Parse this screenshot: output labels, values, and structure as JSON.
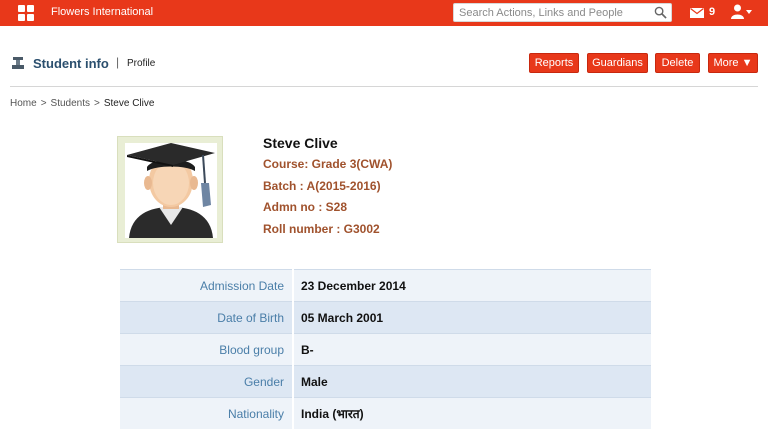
{
  "topbar": {
    "org_name": "Flowers International",
    "search_placeholder": "Search Actions, Links and People",
    "mail_count": "9",
    "accent_color": "#e8381a"
  },
  "header": {
    "title": "Student info",
    "separator": "|",
    "subtitle": "Profile",
    "buttons": {
      "reports": "Reports",
      "guardians": "Guardians",
      "delete": "Delete",
      "more": "More ▼"
    }
  },
  "breadcrumb": {
    "home": "Home",
    "sep1": ">",
    "students": "Students",
    "sep2": ">",
    "current": "Steve Clive"
  },
  "student": {
    "name": "Steve Clive",
    "course": "Course: Grade 3(CWA)",
    "batch": "Batch : A(2015-2016)",
    "admn_no": "Admn no : S28",
    "roll_number": "Roll number : G3002"
  },
  "details": [
    {
      "label": "Admission Date",
      "value": "23 December 2014"
    },
    {
      "label": "Date of Birth",
      "value": "05 March 2001"
    },
    {
      "label": "Blood group",
      "value": "B-"
    },
    {
      "label": "Gender",
      "value": "Male"
    },
    {
      "label": "Nationality",
      "value": "India (भारत)"
    }
  ]
}
